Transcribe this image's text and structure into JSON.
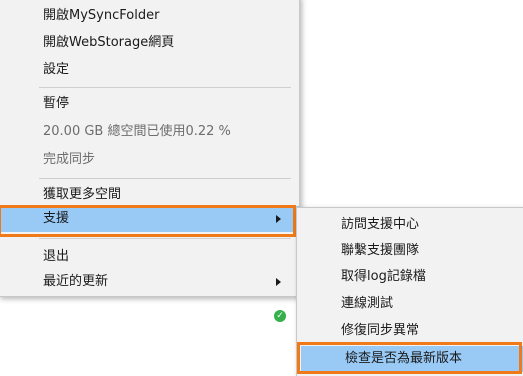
{
  "main_menu": {
    "items": [
      "開啟MySyncFolder",
      "開啟WebStorage網頁",
      "設定",
      "暫停",
      "20.00 GB 總空間已使用0.22 %",
      "完成同步",
      "獲取更多空間",
      "支援",
      "退出",
      "最近的更新"
    ]
  },
  "sub_menu": {
    "items": [
      "訪問支援中心",
      "聯繫支援團隊",
      "取得log記錄檔",
      "連線測試",
      "修復同步異常",
      "檢查是否為最新版本"
    ]
  },
  "colors": {
    "highlight": "#99c9f5",
    "outline": "#f07a1a",
    "status_green": "#35b04a"
  },
  "icons": [
    "submenu-arrow-icon",
    "check-status-icon"
  ]
}
